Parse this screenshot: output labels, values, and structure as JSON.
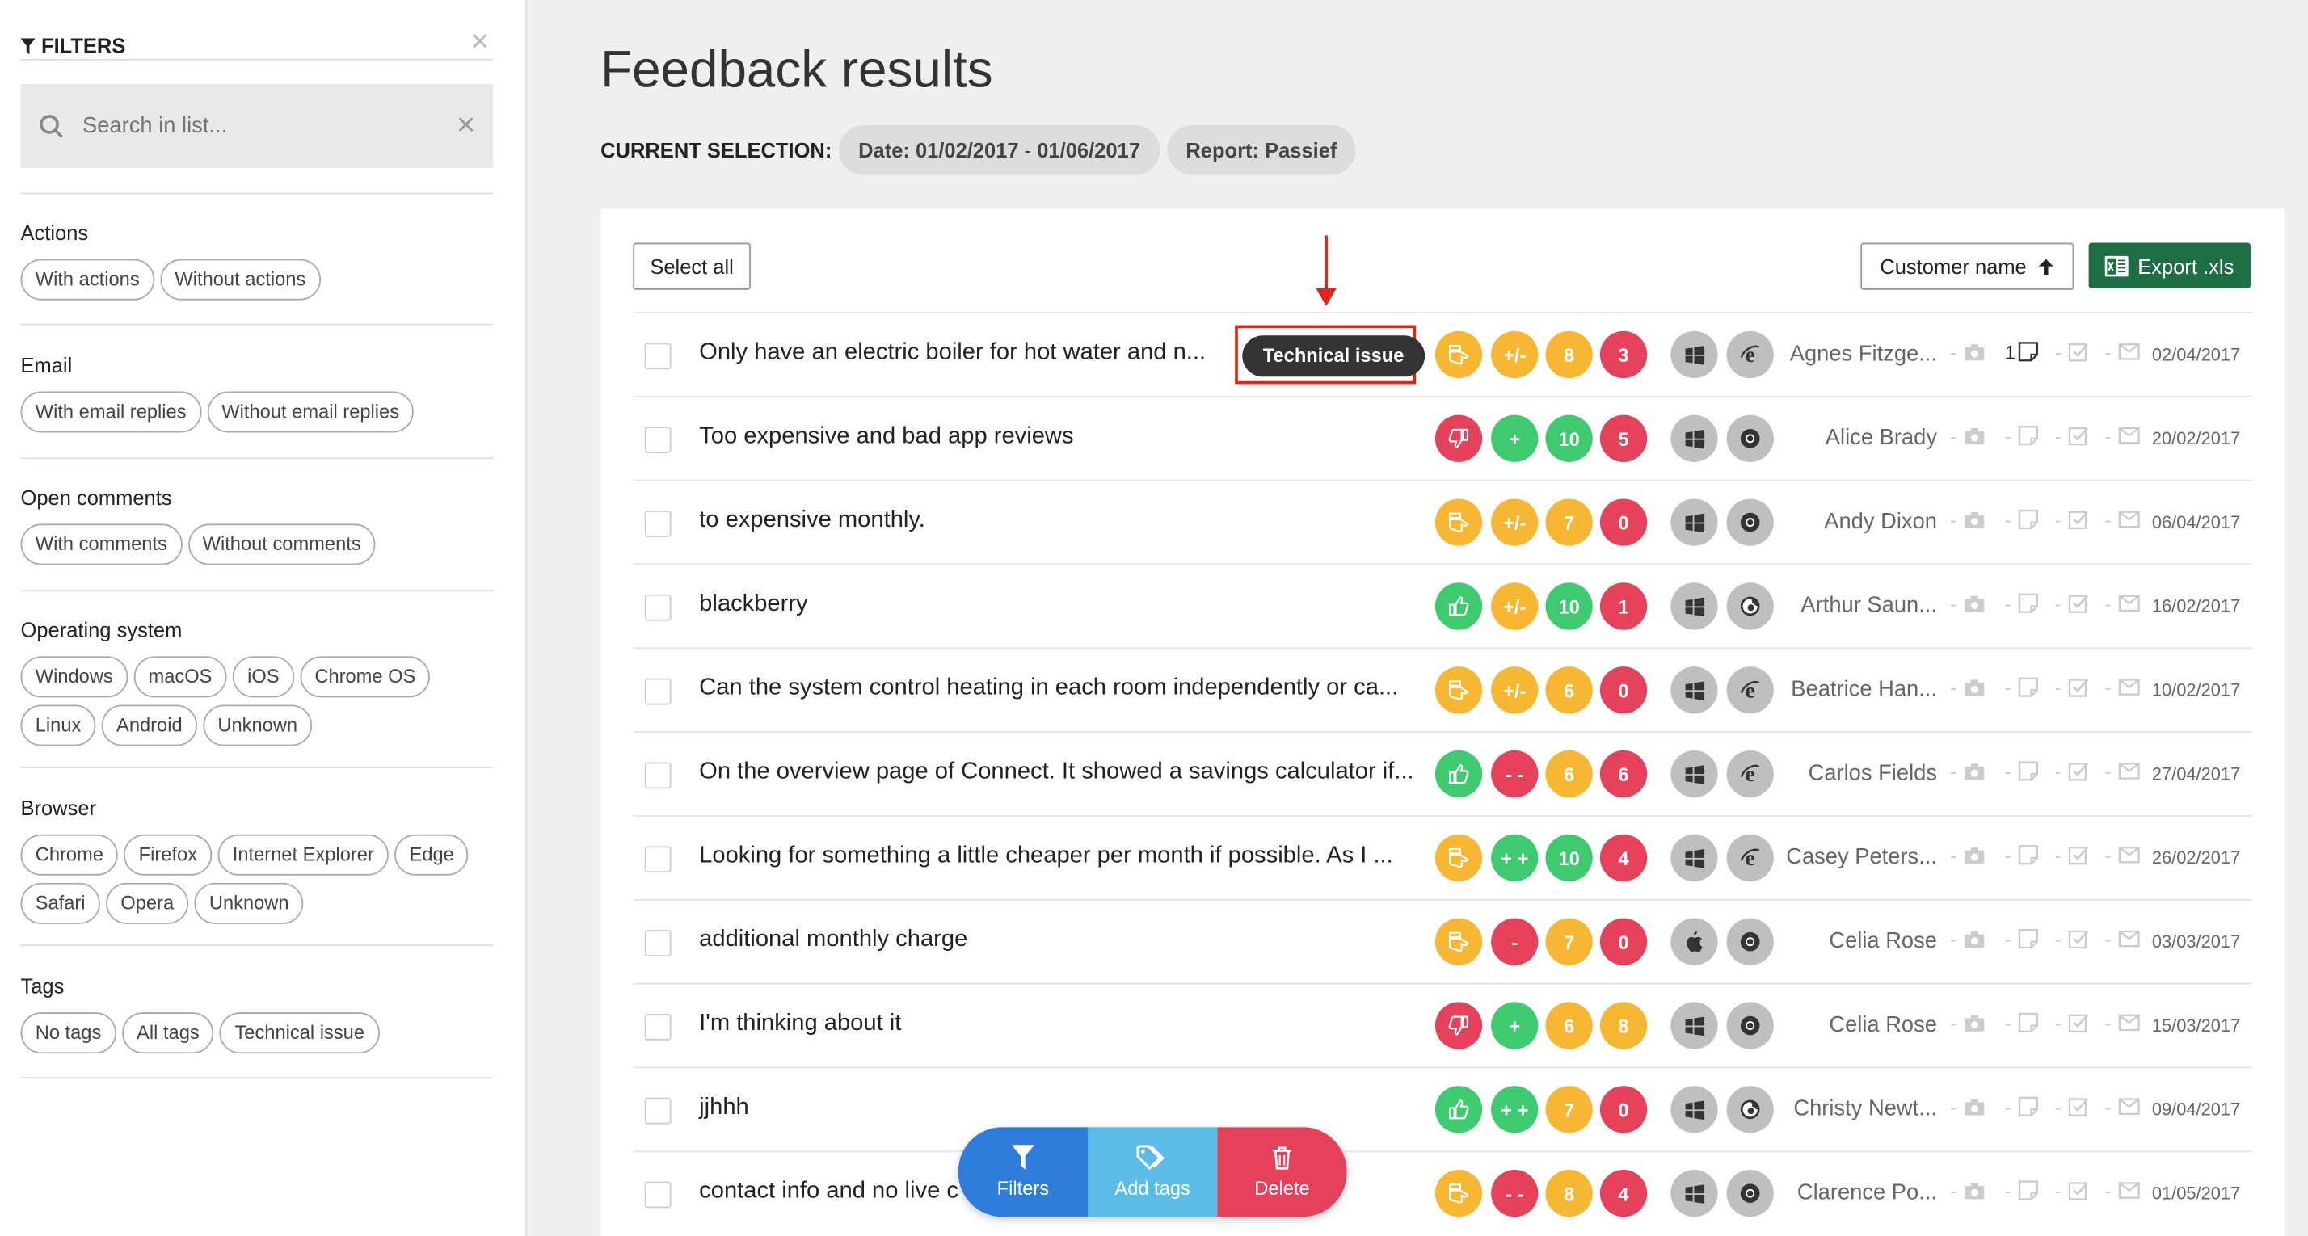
{
  "sidebar": {
    "title": "FILTERS",
    "search_placeholder": "Search in list...",
    "groups": [
      {
        "title": "Actions",
        "chips": [
          "With actions",
          "Without actions"
        ]
      },
      {
        "title": "Email",
        "chips": [
          "With email replies",
          "Without email replies"
        ]
      },
      {
        "title": "Open comments",
        "chips": [
          "With comments",
          "Without comments"
        ]
      },
      {
        "title": "Operating system",
        "chips": [
          "Windows",
          "macOS",
          "iOS",
          "Chrome OS",
          "Linux",
          "Android",
          "Unknown"
        ]
      },
      {
        "title": "Browser",
        "chips": [
          "Chrome",
          "Firefox",
          "Internet Explorer",
          "Edge",
          "Safari",
          "Opera",
          "Unknown"
        ]
      },
      {
        "title": "Tags",
        "chips": [
          "No tags",
          "All tags",
          "Technical issue"
        ]
      }
    ]
  },
  "main": {
    "title": "Feedback results",
    "selection_label": "CURRENT SELECTION:",
    "selection_pills": [
      "Date: 01/02/2017 - 01/06/2017",
      "Report: Passief"
    ],
    "select_all": "Select all",
    "sort_label": "Customer name",
    "export_label": "Export .xls"
  },
  "colors": {
    "yellow": "#f7b733",
    "green": "#3ecb6f",
    "red": "#e5415a",
    "export": "#1d6e43"
  },
  "rows": [
    {
      "comment": "Only have an electric boiler for hot water and n...",
      "tag": "Technical issue",
      "sentiment": "neutral",
      "rating": "+/-",
      "rating_color": "yellow",
      "score": "8",
      "score_color": "yellow",
      "count": "3",
      "count_color": "red",
      "os": "windows-icon",
      "browser": "ie-icon",
      "customer": "Agnes Fitzge...",
      "note_count": "1",
      "date": "02/04/2017"
    },
    {
      "comment": "Too expensive and bad app reviews",
      "sentiment": "negative",
      "rating": "+",
      "rating_color": "green",
      "score": "10",
      "score_color": "green",
      "count": "5",
      "count_color": "red",
      "os": "windows-icon",
      "browser": "chrome-icon",
      "customer": "Alice Brady",
      "date": "20/02/2017"
    },
    {
      "comment": "to expensive monthly.",
      "sentiment": "neutral",
      "rating": "+/-",
      "rating_color": "yellow",
      "score": "7",
      "score_color": "yellow",
      "count": "0",
      "count_color": "red",
      "os": "windows-icon",
      "browser": "chrome-icon",
      "customer": "Andy Dixon",
      "date": "06/04/2017"
    },
    {
      "comment": "blackberry",
      "sentiment": "positive",
      "rating": "+/-",
      "rating_color": "yellow",
      "score": "10",
      "score_color": "green",
      "count": "1",
      "count_color": "red",
      "os": "windows-icon",
      "browser": "firefox-icon",
      "customer": "Arthur Saun...",
      "date": "16/02/2017"
    },
    {
      "comment": "Can the system control heating in each room independently or ca...",
      "sentiment": "neutral",
      "rating": "+/-",
      "rating_color": "yellow",
      "score": "6",
      "score_color": "yellow",
      "count": "0",
      "count_color": "red",
      "os": "windows-icon",
      "browser": "ie-icon",
      "customer": "Beatrice Han...",
      "date": "10/02/2017"
    },
    {
      "comment": "On the overview page of Connect. It showed a savings calculator if...",
      "sentiment": "positive",
      "rating": "- -",
      "rating_color": "red",
      "score": "6",
      "score_color": "yellow",
      "count": "6",
      "count_color": "red",
      "os": "windows-icon",
      "browser": "ie-icon",
      "customer": "Carlos Fields",
      "date": "27/04/2017"
    },
    {
      "comment": "Looking for something a little cheaper per month if possible. As I ...",
      "sentiment": "neutral",
      "rating": "+ +",
      "rating_color": "green",
      "score": "10",
      "score_color": "green",
      "count": "4",
      "count_color": "red",
      "os": "windows-icon",
      "browser": "ie-icon",
      "customer": "Casey Peters...",
      "date": "26/02/2017"
    },
    {
      "comment": "additional monthly charge",
      "sentiment": "neutral",
      "rating": "-",
      "rating_color": "red",
      "score": "7",
      "score_color": "yellow",
      "count": "0",
      "count_color": "red",
      "os": "apple-icon",
      "browser": "chrome-icon",
      "customer": "Celia Rose",
      "date": "03/03/2017"
    },
    {
      "comment": "I'm thinking about it",
      "sentiment": "negative",
      "rating": "+",
      "rating_color": "green",
      "score": "6",
      "score_color": "yellow",
      "count": "8",
      "count_color": "yellow",
      "os": "windows-icon",
      "browser": "chrome-icon",
      "customer": "Celia Rose",
      "date": "15/03/2017"
    },
    {
      "comment": "jjhhh",
      "sentiment": "positive",
      "rating": "+ +",
      "rating_color": "green",
      "score": "7",
      "score_color": "yellow",
      "count": "0",
      "count_color": "red",
      "os": "windows-icon",
      "browser": "firefox-icon",
      "customer": "Christy Newt...",
      "date": "09/04/2017"
    },
    {
      "comment": "contact info and no live c",
      "sentiment": "neutral",
      "rating": "- -",
      "rating_color": "red",
      "score": "8",
      "score_color": "yellow",
      "count": "4",
      "count_color": "red",
      "os": "windows-icon",
      "browser": "chrome-icon",
      "customer": "Clarence Po...",
      "date": "01/05/2017"
    }
  ],
  "action_bar": {
    "filters": "Filters",
    "add_tags": "Add tags",
    "delete": "Delete"
  }
}
